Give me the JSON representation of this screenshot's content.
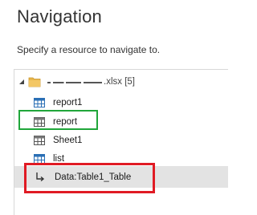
{
  "header": {
    "title": "Navigation",
    "subtitle": "Specify a resource to navigate to."
  },
  "tree": {
    "root": {
      "label_suffix": ".xlsx [5]",
      "icon": "folder-icon",
      "expanded": true
    },
    "items": [
      {
        "label": "report1",
        "icon": "table-icon"
      },
      {
        "label": "report",
        "icon": "table-icon"
      },
      {
        "label": "Sheet1",
        "icon": "table-icon"
      },
      {
        "label": "list",
        "icon": "table-icon"
      },
      {
        "label": "Data:Table1_Table",
        "icon": "child-arrow-icon",
        "selected": true
      }
    ]
  },
  "colors": {
    "highlight_green": "#20a63a",
    "highlight_red": "#e01b24",
    "selected_row_bg": "#e3e3e3",
    "table_icon": "#2a6fb5",
    "folder_icon": "#e8b64c"
  }
}
